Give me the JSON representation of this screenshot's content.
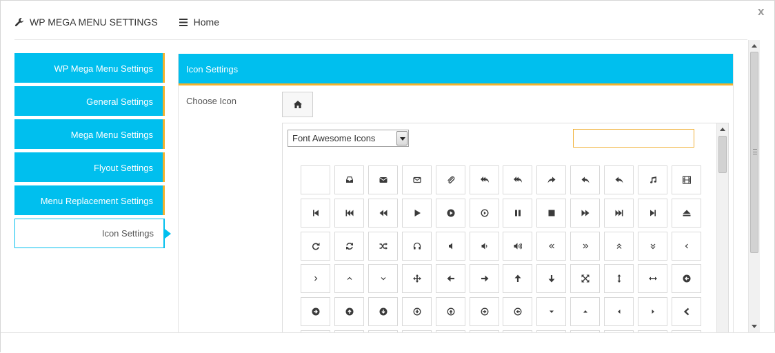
{
  "header": {
    "title": "WP MEGA MENU SETTINGS",
    "home_label": "Home",
    "close_label": "x"
  },
  "sidebar": {
    "items": [
      {
        "label": "WP Mega Menu Settings",
        "active": false
      },
      {
        "label": "General Settings",
        "active": false
      },
      {
        "label": "Mega Menu Settings",
        "active": false
      },
      {
        "label": "Flyout Settings",
        "active": false
      },
      {
        "label": "Menu Replacement Settings",
        "active": false
      },
      {
        "label": "Icon Settings",
        "active": true
      }
    ]
  },
  "panel": {
    "title": "Icon Settings",
    "choose_label": "Choose Icon",
    "selected_icon": "home-icon"
  },
  "picker": {
    "select_value": "Font Awesome Icons",
    "search_value": "",
    "search_placeholder": ""
  },
  "icons": [
    [
      "blank",
      "inbox",
      "envelope",
      "envelope-o",
      "paperclip",
      "reply-all",
      "mail-reply-all",
      "share",
      "reply",
      "mail-reply",
      "music",
      "film"
    ],
    [
      "step-backward",
      "fast-backward",
      "backward",
      "play",
      "play-circle",
      "play-circle-o",
      "pause",
      "stop",
      "forward",
      "fast-forward",
      "step-forward",
      "eject"
    ],
    [
      "repeat",
      "refresh",
      "random",
      "headphones",
      "volume-off",
      "volume-down",
      "volume-up",
      "angle-double-left",
      "angle-double-right",
      "angle-double-up",
      "angle-double-down",
      "angle-left"
    ],
    [
      "angle-right",
      "angle-up",
      "angle-down",
      "arrows",
      "arrow-left",
      "arrow-right",
      "arrow-up",
      "arrow-down",
      "expand",
      "arrows-v",
      "arrows-h",
      "arrow-circle-left"
    ],
    [
      "arrow-circle-right",
      "arrow-circle-up",
      "arrow-circle-down",
      "arrow-circle-o-down",
      "arrow-circle-o-up",
      "arrow-circle-o-right",
      "arrow-circle-o-left",
      "caret-down",
      "caret-up",
      "caret-left",
      "caret-right",
      "chevron-left"
    ]
  ],
  "colors": {
    "accent": "#00bfee",
    "accent_border": "#f2b22e",
    "icon": "#3a3a3a"
  }
}
